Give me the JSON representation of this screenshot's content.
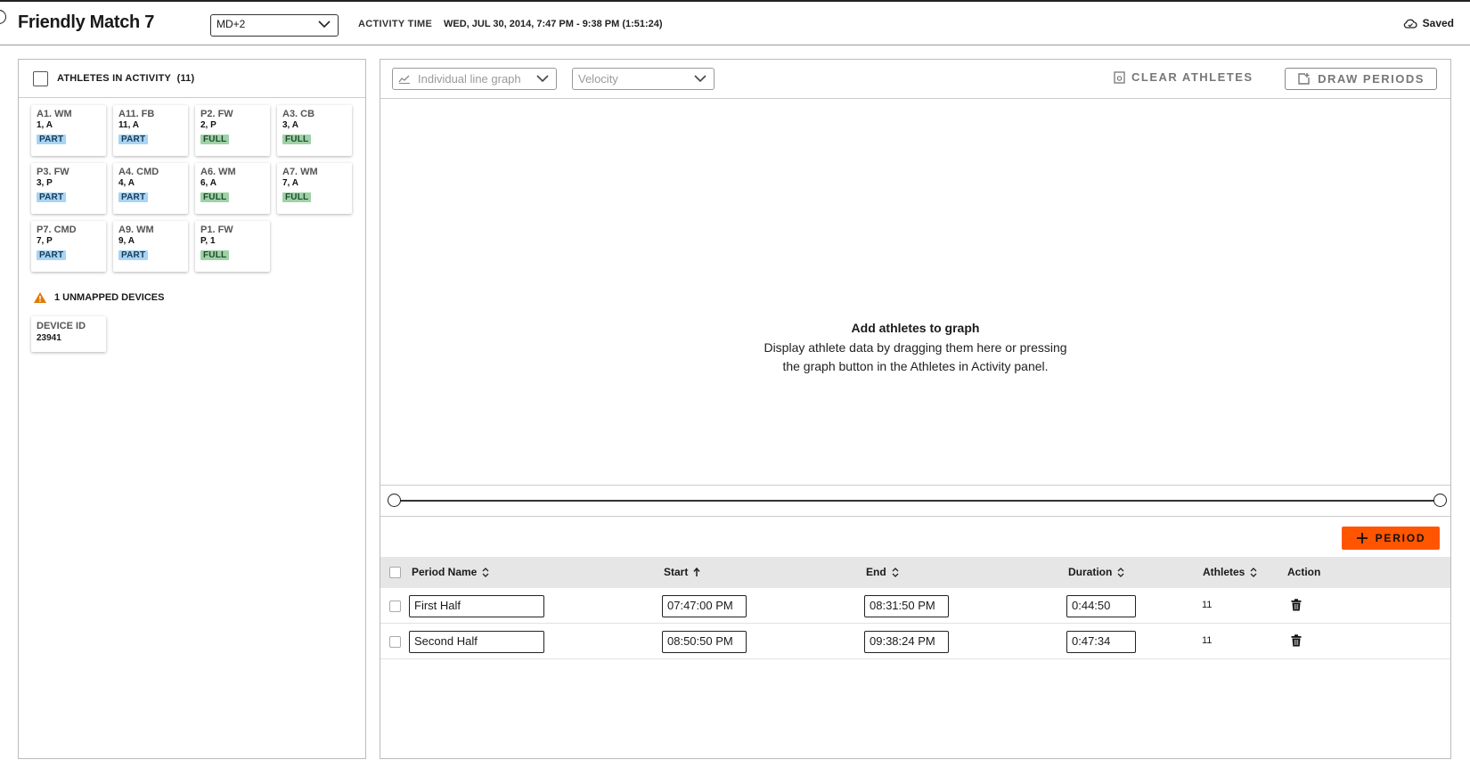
{
  "header": {
    "title": "Friendly Match 7",
    "md_select": "MD+2",
    "activity_label": "ACTIVITY TIME",
    "activity_value": "WED, JUL 30, 2014, 7:47 PM - 9:38 PM (1:51:24)",
    "saved_label": "Saved"
  },
  "athletes_panel": {
    "header_label": "ATHLETES IN ACTIVITY",
    "count": "(11)",
    "athletes": [
      {
        "pos": "A1. WM",
        "num": "1, A",
        "status": "PART"
      },
      {
        "pos": "A11. FB",
        "num": "11, A",
        "status": "PART"
      },
      {
        "pos": "P2. FW",
        "num": "2, P",
        "status": "FULL"
      },
      {
        "pos": "A3. CB",
        "num": "3, A",
        "status": "FULL"
      },
      {
        "pos": "P3. FW",
        "num": "3, P",
        "status": "PART"
      },
      {
        "pos": "A4. CMD",
        "num": "4, A",
        "status": "PART"
      },
      {
        "pos": "A6. WM",
        "num": "6, A",
        "status": "FULL"
      },
      {
        "pos": "A7. WM",
        "num": "7, A",
        "status": "FULL"
      },
      {
        "pos": "P7. CMD",
        "num": "7, P",
        "status": "PART"
      },
      {
        "pos": "A9. WM",
        "num": "9, A",
        "status": "PART"
      },
      {
        "pos": "P1. FW",
        "num": "P, 1",
        "status": "FULL"
      }
    ],
    "unmapped_label": "1 UNMAPPED DEVICES",
    "device_label": "DEVICE ID",
    "device_id": "23941"
  },
  "graph_panel": {
    "graph_type": "Individual line graph",
    "metric": "Velocity",
    "clear_label": "CLEAR ATHLETES",
    "draw_label": "DRAW PERIODS",
    "empty_title": "Add athletes to graph",
    "empty_line1": "Display athlete data by dragging them here or pressing",
    "empty_line2": "the graph button in the Athletes in Activity panel.",
    "period_button": "PERIOD"
  },
  "periods_table": {
    "headers": {
      "name": "Period Name",
      "start": "Start",
      "end": "End",
      "duration": "Duration",
      "athletes": "Athletes",
      "action": "Action"
    },
    "rows": [
      {
        "name": "First Half",
        "start": "07:47:00 PM",
        "end": "08:31:50 PM",
        "duration": "0:44:50",
        "athletes": "11"
      },
      {
        "name": "Second Half",
        "start": "08:50:50 PM",
        "end": "09:38:24 PM",
        "duration": "0:47:34",
        "athletes": "11"
      }
    ]
  },
  "colors": {
    "accent": "#ff5500",
    "part_badge": "#a8d4f5",
    "full_badge": "#9fd1a8",
    "warning": "#e07b00"
  },
  "icons": [
    "back-icon",
    "chevron-down-icon",
    "cloud-saved-icon",
    "warning-icon",
    "line-graph-icon",
    "clear-icon",
    "draw-period-icon",
    "plus-icon",
    "sort-icon",
    "sort-up-icon",
    "trash-icon"
  ]
}
